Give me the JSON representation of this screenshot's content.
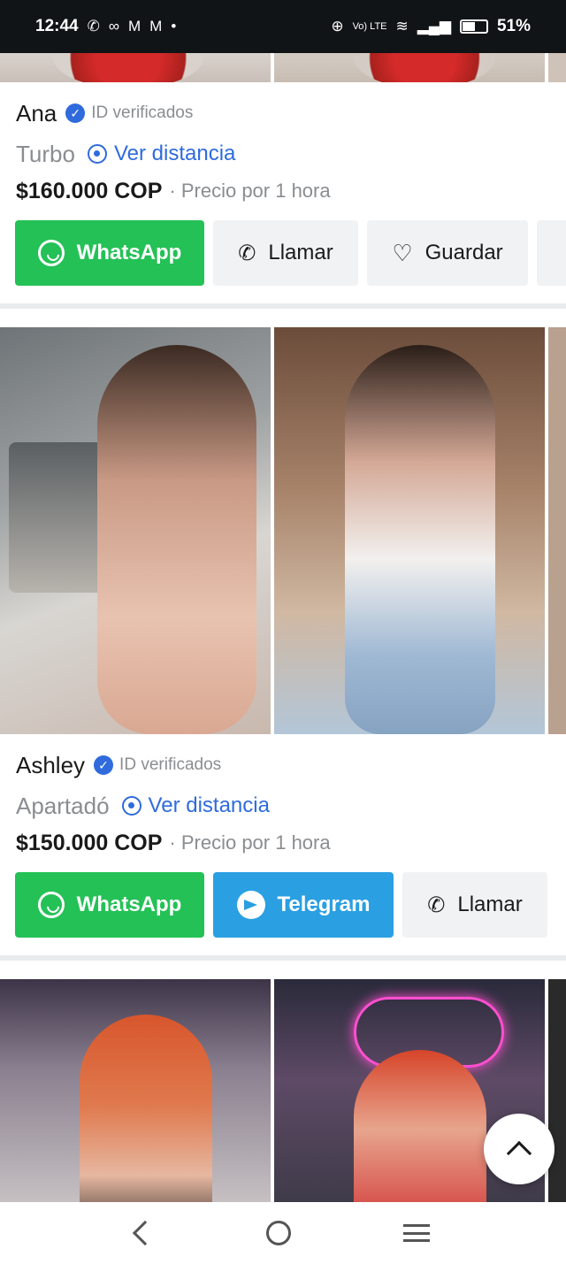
{
  "status_bar": {
    "time": "12:44",
    "notification_icons": [
      "whatsapp-icon",
      "voicemail-icon",
      "gmail-icon",
      "gmail-icon",
      "dot-icon"
    ],
    "network_label": "Vo) LTE",
    "battery_percent": "51%"
  },
  "listings": [
    {
      "name": "Ana",
      "verified_label": "ID verificados",
      "location": "Turbo",
      "distance_label": "Ver distancia",
      "price": "$160.000 COP",
      "price_note": "· Precio por 1 hora",
      "buttons": [
        {
          "label": "WhatsApp",
          "kind": "whatsapp"
        },
        {
          "label": "Llamar",
          "kind": "call"
        },
        {
          "label": "Guardar",
          "kind": "save"
        }
      ]
    },
    {
      "name": "Ashley",
      "verified_label": "ID verificados",
      "location": "Apartadó",
      "distance_label": "Ver distancia",
      "price": "$150.000 COP",
      "price_note": "· Precio por 1 hora",
      "buttons": [
        {
          "label": "WhatsApp",
          "kind": "whatsapp"
        },
        {
          "label": "Telegram",
          "kind": "telegram"
        },
        {
          "label": "Llamar",
          "kind": "call"
        }
      ]
    }
  ],
  "colors": {
    "whatsapp": "#24c156",
    "telegram": "#2a9fe2",
    "link_blue": "#2f6bdc",
    "muted": "#8a8d91"
  }
}
